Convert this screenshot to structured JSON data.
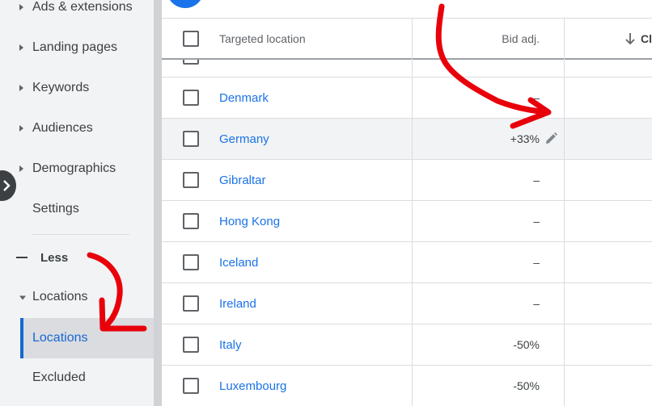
{
  "sidebar": {
    "items": [
      {
        "label": "Ads & extensions"
      },
      {
        "label": "Landing pages"
      },
      {
        "label": "Keywords"
      },
      {
        "label": "Audiences"
      },
      {
        "label": "Demographics"
      },
      {
        "label": "Settings"
      }
    ],
    "less_label": "Less",
    "locations_group_label": "Locations",
    "locations_sub": {
      "active_label": "Locations",
      "excluded_label": "Excluded"
    }
  },
  "table": {
    "headers": {
      "location": "Targeted location",
      "bid": "Bid adj.",
      "sorted_col": "Cl"
    },
    "rows": [
      {
        "location": "Denmark",
        "bid": "–"
      },
      {
        "location": "Germany",
        "bid": "+33%"
      },
      {
        "location": "Gibraltar",
        "bid": "–"
      },
      {
        "location": "Hong Kong",
        "bid": "–"
      },
      {
        "location": "Iceland",
        "bid": "–"
      },
      {
        "location": "Ireland",
        "bid": "–"
      },
      {
        "location": "Italy",
        "bid": "-50%"
      },
      {
        "location": "Luxembourg",
        "bid": "-50%"
      }
    ]
  },
  "colors": {
    "accent": "#1a73e8",
    "annotation": "#e8000b",
    "sidebar_bg": "#f1f3f4"
  }
}
